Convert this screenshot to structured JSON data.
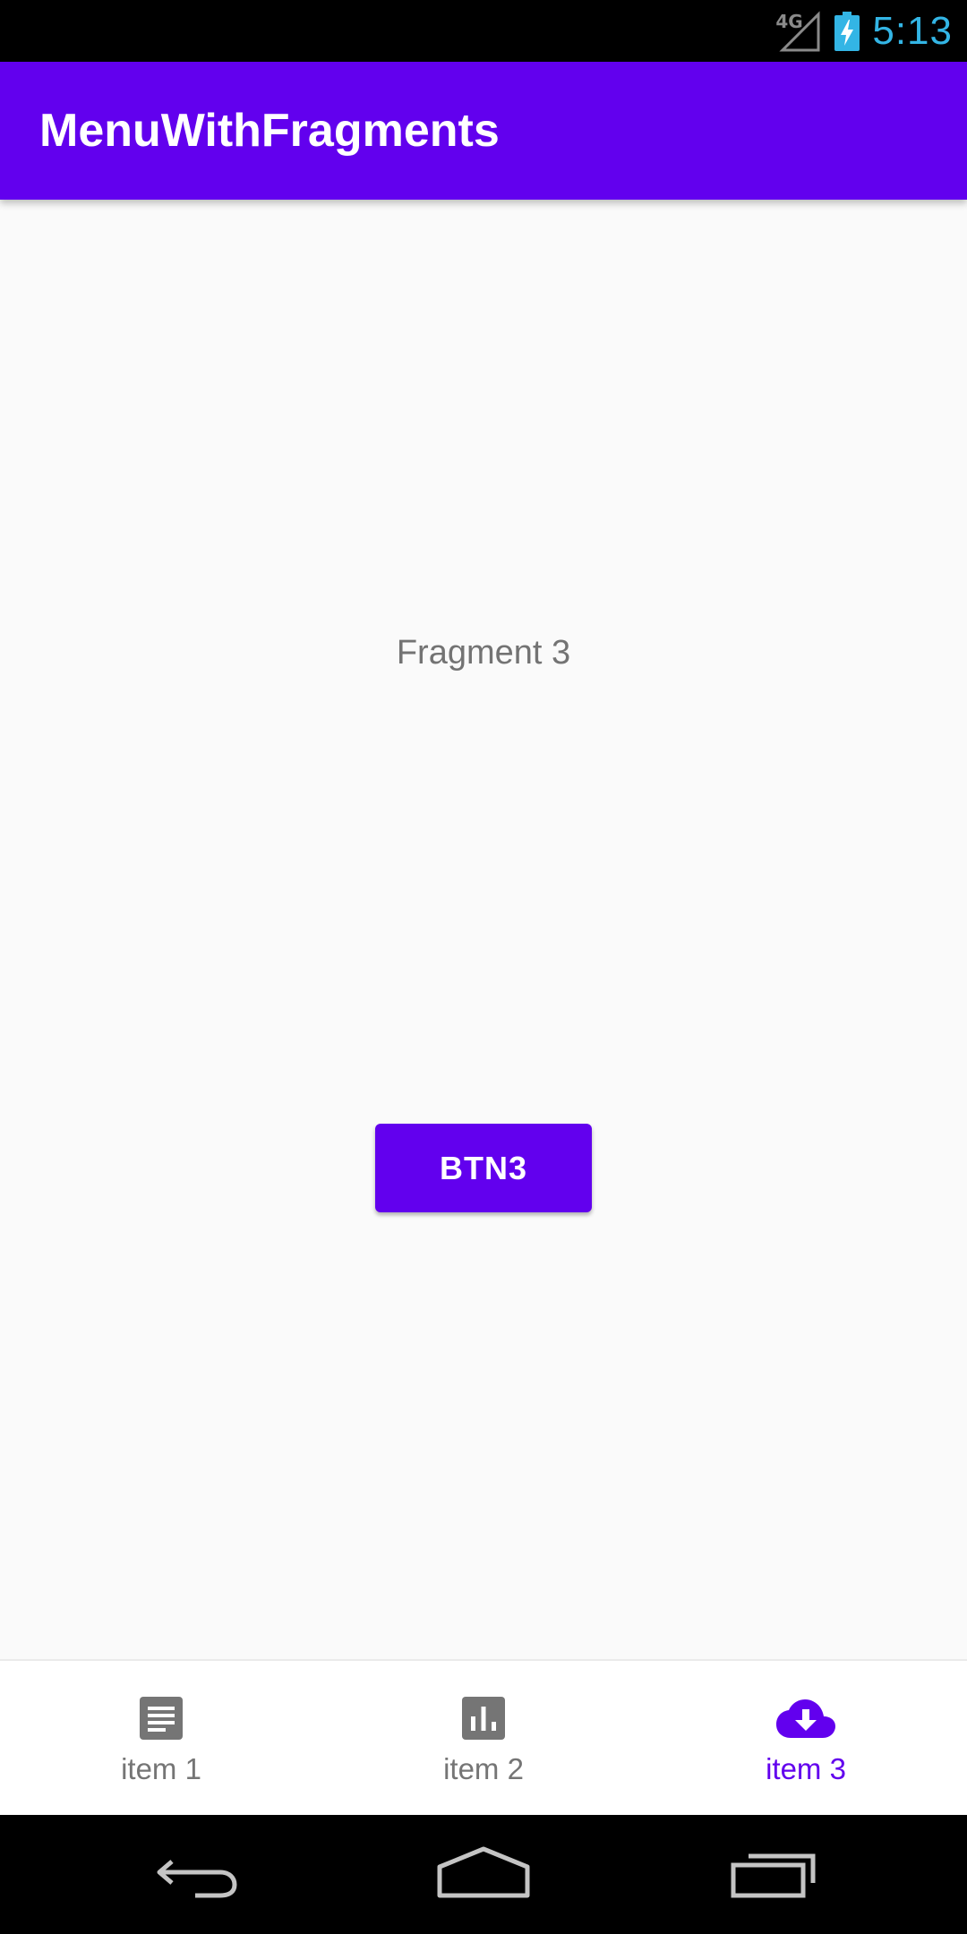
{
  "status_bar": {
    "network_type": "4G",
    "time": "5:13",
    "icons": [
      "signal-icon",
      "battery-charging-icon"
    ]
  },
  "app_bar": {
    "title": "MenuWithFragments"
  },
  "content": {
    "fragment_label": "Fragment 3",
    "button_label": "BTN3"
  },
  "bottom_nav": {
    "items": [
      {
        "label": "item 1",
        "icon": "article-icon",
        "selected": false
      },
      {
        "label": "item 2",
        "icon": "bar-chart-icon",
        "selected": false
      },
      {
        "label": "item 3",
        "icon": "cloud-download-icon",
        "selected": true
      }
    ]
  },
  "system_nav": {
    "buttons": [
      "back-icon",
      "home-icon",
      "recents-icon"
    ]
  },
  "colors": {
    "primary": "#6200ee",
    "clock": "#33b5e5",
    "inactive": "#757575",
    "background": "#fafafa"
  }
}
